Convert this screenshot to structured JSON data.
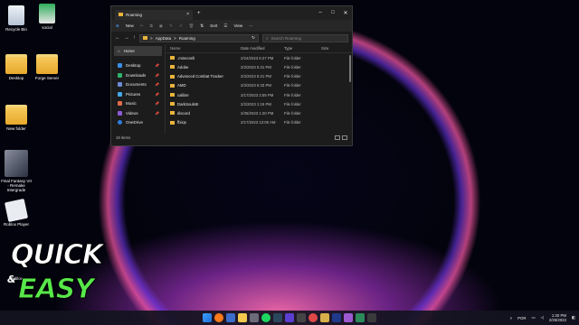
{
  "desktop": {
    "icons": [
      {
        "label": "Recycle Bin"
      },
      {
        "label": "social"
      },
      {
        "label": "Desktop"
      },
      {
        "label": "Forge Server"
      },
      {
        "label": "New folder"
      },
      {
        "label": "Final Fantasy VII - Remake Intergrade"
      },
      {
        "label": "Roblox Player"
      },
      {
        "label": "Roblox"
      }
    ],
    "overlay": {
      "line1": "QUICK",
      "amp": "&",
      "line2": "EASY"
    }
  },
  "explorer": {
    "tab_title": "Roaming",
    "tab_close": "×",
    "new_tab": "+",
    "window_buttons": {
      "minimize": "–",
      "maximize": "□",
      "close": "✕"
    },
    "toolbar": {
      "new_label": "New",
      "sort_label": "Sort",
      "view_label": "View",
      "more": "···"
    },
    "address": {
      "parts": [
        "AppData",
        "Roaming"
      ],
      "separator": ">"
    },
    "search": {
      "placeholder": "Search Roaming"
    },
    "sidebar": [
      {
        "label": "Home",
        "icon": "home-icon",
        "selected": true
      },
      {
        "label": "Desktop",
        "icon": "desktop-icon"
      },
      {
        "label": "Downloads",
        "icon": "downloads-icon"
      },
      {
        "label": "Documents",
        "icon": "documents-icon"
      },
      {
        "label": "Pictures",
        "icon": "pictures-icon"
      },
      {
        "label": "Music",
        "icon": "music-icon"
      },
      {
        "label": "Videos",
        "icon": "videos-icon"
      },
      {
        "label": "OneDrive",
        "icon": "onedrive-icon"
      }
    ],
    "columns": [
      "Name",
      "Date modified",
      "Type",
      "Size"
    ],
    "rows": [
      {
        "name": ".minecraft",
        "date": "2/24/2023 6:27 PM",
        "type": "File folder"
      },
      {
        "name": "Adobe",
        "date": "2/2/2023 5:31 PM",
        "type": "File folder"
      },
      {
        "name": "Advanced Combat Tracker",
        "date": "2/2/2023 6:21 PM",
        "type": "File folder"
      },
      {
        "name": "AMD",
        "date": "2/2/2023 6:33 PM",
        "type": "File folder"
      },
      {
        "name": "calibre",
        "date": "2/17/2023 2:59 PM",
        "type": "File folder"
      },
      {
        "name": "DarkSoulsIII",
        "date": "2/2/2023 1:19 PM",
        "type": "File folder"
      },
      {
        "name": "discord",
        "date": "2/25/2023 1:20 PM",
        "type": "File folder"
      },
      {
        "name": "ffxiqs",
        "date": "2/17/2023 12:05 AM",
        "type": "File folder"
      }
    ],
    "status": "19 items"
  },
  "taskbar": {
    "tray": {
      "lang": "POR",
      "time": "1:20 PM",
      "date": "2/25/2023"
    }
  }
}
